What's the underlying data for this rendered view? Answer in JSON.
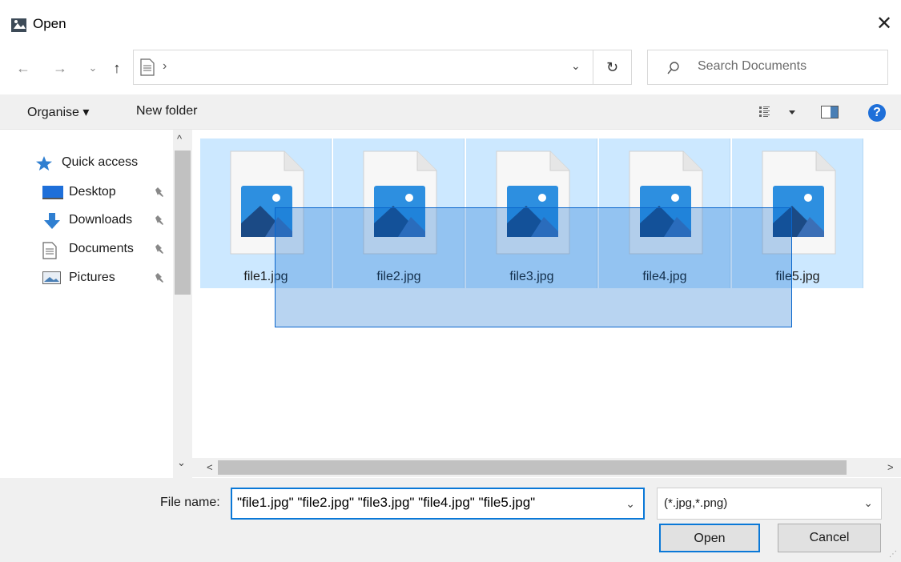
{
  "window": {
    "title": "Open",
    "close_glyph": "✕"
  },
  "nav": {
    "back_glyph": "←",
    "forward_glyph": "→",
    "recent_glyph": "⌄",
    "up_glyph": "↑",
    "address_separator": "›",
    "address_dropdown_glyph": "⌄",
    "refresh_glyph": "↻",
    "search_placeholder": "Search Documents"
  },
  "toolbar": {
    "organise_label": "Organise ▾",
    "new_folder_label": "New folder",
    "view_dropdown_glyph": "▾",
    "help_label": "?"
  },
  "sidebar": {
    "quick_access": "Quick access",
    "items": [
      {
        "label": "Desktop",
        "icon": "desktop-icon",
        "pin": "📌"
      },
      {
        "label": "Downloads",
        "icon": "download-icon",
        "pin": "📌"
      },
      {
        "label": "Documents",
        "icon": "document-icon",
        "pin": "📌"
      },
      {
        "label": "Pictures",
        "icon": "pictures-icon",
        "pin": "📌"
      }
    ]
  },
  "files": [
    {
      "name": "file1.jpg"
    },
    {
      "name": "file2.jpg"
    },
    {
      "name": "file3.jpg"
    },
    {
      "name": "file4.jpg"
    },
    {
      "name": "file5.jpg"
    }
  ],
  "scroll": {
    "up": "^",
    "down": "⌄",
    "left": "<",
    "right": ">"
  },
  "bottom": {
    "file_name_label": "File name:",
    "file_name_value": "\"file1.jpg\" \"file2.jpg\" \"file3.jpg\" \"file4.jpg\" \"file5.jpg\"",
    "file_name_dropdown": "⌄",
    "filter_value": "(*.jpg,*.png)",
    "filter_dropdown": "⌄",
    "open_label": "Open",
    "cancel_label": "Cancel"
  },
  "colors": {
    "selection_fill": "#cce8ff",
    "accent": "#0a78d7",
    "chrome_bg": "#f0f0f0"
  }
}
